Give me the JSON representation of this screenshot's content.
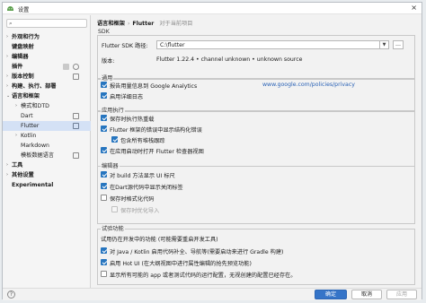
{
  "window": {
    "title": "设置"
  },
  "search": {
    "placeholder": ""
  },
  "sidebar": {
    "items": [
      {
        "label": "外观和行为",
        "arrow": "›"
      },
      {
        "label": "键盘映射",
        "arrow": ""
      },
      {
        "label": "编辑器",
        "arrow": "›"
      },
      {
        "label": "插件",
        "arrow": ""
      },
      {
        "label": "版本控制",
        "arrow": "›"
      },
      {
        "label": "构建、执行、部署",
        "arrow": "›"
      },
      {
        "label": "语言和框架",
        "arrow": "⌄"
      },
      {
        "label": "模式和DTD",
        "arrow": "›"
      },
      {
        "label": "Dart",
        "arrow": ""
      },
      {
        "label": "Flutter",
        "arrow": ""
      },
      {
        "label": "Kotlin",
        "arrow": "›"
      },
      {
        "label": "Markdown",
        "arrow": ""
      },
      {
        "label": "模板数据语言",
        "arrow": ""
      },
      {
        "label": "工具",
        "arrow": "›"
      },
      {
        "label": "其他设置",
        "arrow": "›"
      },
      {
        "label": "Experimental",
        "arrow": ""
      }
    ]
  },
  "breadcrumb": {
    "parent": "语言和框架",
    "separator": "›",
    "current": "Flutter",
    "note": "对于当前项目"
  },
  "sdk": {
    "section": "SDK",
    "path_label": "Flutter SDK 路径:",
    "path_value": "C:\\flutter",
    "version_label": "版本:",
    "version_value": "Flutter 1.22.4 • channel unknown • unknown source"
  },
  "general": {
    "title": "通用",
    "analytics": "报告用量信息到 Google Analytics",
    "analytics_link": "www.google.com/policies/privacy",
    "log": "启用详细日志"
  },
  "run": {
    "title": "应用执行",
    "hot_reload": "保存时执行热重载",
    "show_errors": "Flutter 框架的错误中显示结构化错误",
    "show_all_stack": "包含所有堆栈跟踪",
    "open_inspector": "在应用启动时打开 Flutter 检查器视图"
  },
  "editor": {
    "title": "编辑器",
    "build_labels": "对 build 方法显示 UI 标尺",
    "closing_labels": "在Dart源代码中显示关闭标签",
    "format_on_save": "保存时格式化代码",
    "organize_imports": "保存时优化导入"
  },
  "experimental": {
    "title": "试验功能",
    "note": "试用仍在开发中的功能 (可能需要重启开发工具)",
    "gradle": "对 Java / Kotlin 启用代码补全、导航等(需要启动来进行 Gradle 构建)",
    "hot_ui": "启用 Hot UI (在大纲视图中进行属性编辑的抢先预览功能)",
    "all_run": "显示所有可能的 app 或者测试代码的运行配置，无视创建的配置已经存在。"
  },
  "footer": {
    "help": "?",
    "ok": "确定",
    "cancel": "取消",
    "apply": "应用"
  }
}
